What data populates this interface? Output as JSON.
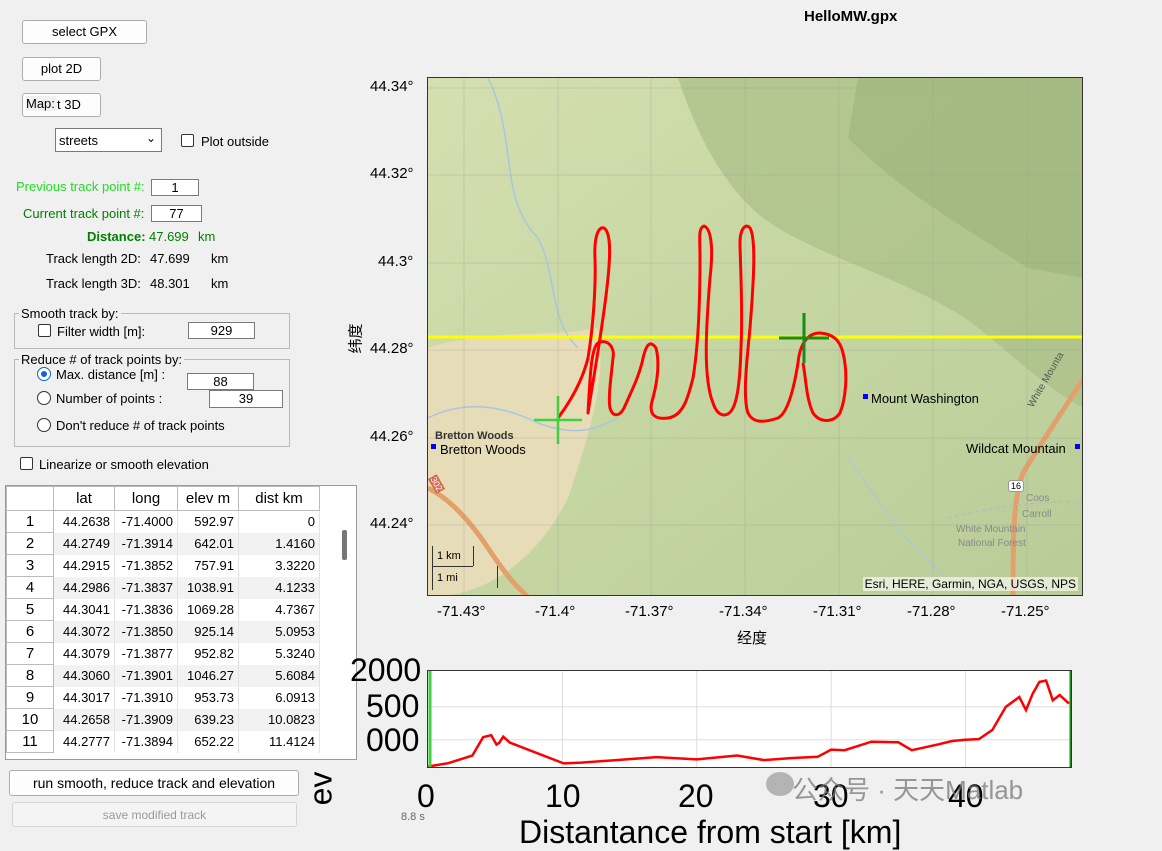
{
  "title": "HelloMW.gpx",
  "buttons": {
    "select_gpx": "select GPX",
    "plot_2d": "plot 2D",
    "plot_3d": "t 3D",
    "map_label": "Map:",
    "run": "run smooth, reduce track and elevation",
    "save": "save modified track"
  },
  "map_style": {
    "selected": "streets"
  },
  "plot_outside": {
    "label": "Plot outside",
    "checked": false
  },
  "track": {
    "prev_label": "Previous track point #:",
    "prev_value": "1",
    "cur_label": "Current track point #:",
    "cur_value": "77",
    "distance_label": "Distance:",
    "distance_value": "47.699",
    "distance_unit": "km",
    "len2d_label": "Track length 2D:",
    "len2d_value": "47.699",
    "len2d_unit": "km",
    "len3d_label": "Track length 3D:",
    "len3d_value": "48.301",
    "len3d_unit": "km"
  },
  "smooth": {
    "title": "Smooth track by:",
    "filter_label": "Filter width [m]:",
    "filter_value": "929",
    "checked": false
  },
  "reduce": {
    "title": "Reduce # of track points by:",
    "max_dist_label": "Max. distance [m] :",
    "max_dist_value": "88",
    "num_points_label": "Number of points :",
    "num_points_value": "39",
    "dont_reduce_label": "Don't reduce # of track points",
    "selected": "max_distance"
  },
  "linearize": {
    "label": "Linearize or smooth elevation",
    "checked": false
  },
  "table": {
    "headers": [
      "lat",
      "long",
      "elev m",
      "dist km"
    ],
    "rows": [
      [
        "1",
        "44.2638",
        "-71.4000",
        "592.97",
        "0"
      ],
      [
        "2",
        "44.2749",
        "-71.3914",
        "642.01",
        "1.4160"
      ],
      [
        "3",
        "44.2915",
        "-71.3852",
        "757.91",
        "3.3220"
      ],
      [
        "4",
        "44.2986",
        "-71.3837",
        "1038.91",
        "4.1233"
      ],
      [
        "5",
        "44.3041",
        "-71.3836",
        "1069.28",
        "4.7367"
      ],
      [
        "6",
        "44.3072",
        "-71.3850",
        "925.14",
        "5.0953"
      ],
      [
        "7",
        "44.3079",
        "-71.3877",
        "952.82",
        "5.3240"
      ],
      [
        "8",
        "44.3060",
        "-71.3901",
        "1046.27",
        "5.6084"
      ],
      [
        "9",
        "44.3017",
        "-71.3910",
        "953.73",
        "6.0913"
      ],
      [
        "10",
        "44.2658",
        "-71.3909",
        "639.23",
        "10.0823"
      ],
      [
        "11",
        "44.2777",
        "-71.3894",
        "652.22",
        "11.4124"
      ]
    ]
  },
  "map": {
    "y_ticks": [
      "44.34°",
      "44.32°",
      "44.3°",
      "44.28°",
      "44.26°",
      "44.24°"
    ],
    "x_ticks": [
      "-71.43°",
      "-71.4°",
      "-71.37°",
      "-71.34°",
      "-71.31°",
      "-71.28°",
      "-71.25°"
    ],
    "ylabel": "纬度",
    "xlabel": "经度",
    "places": [
      "Bretton Woods",
      "Bretton Woods",
      "Mount Washington",
      "Wildcat Mountain",
      "Coos",
      "Carroll",
      "White Mountain",
      "National Forest",
      "White Mounta",
      "16",
      "302"
    ],
    "scale_km": "1 km",
    "scale_mi": "1 mi",
    "attribution": "Esri, HERE, Garmin, NGA, USGS, NPS"
  },
  "elevation_chart": {
    "y_ticks": [
      "2000",
      "500",
      "000"
    ],
    "x_ticks": [
      "0",
      "10",
      "20",
      "30",
      "40"
    ],
    "xlabel": "Distantance from start [km]",
    "ylabel": "ev",
    "time_text": "8.8 s"
  },
  "watermark": "公众号 · 天天Matlab",
  "colors": {
    "track": "#ff0000",
    "start": "#3fd13f",
    "current": "#1a8a1a",
    "yellow": "#ffff00",
    "prev_label": "#00c800",
    "cur_label": "#008000"
  },
  "chart_data": {
    "type": "line",
    "x": [
      0,
      1.5,
      3.3,
      4.1,
      4.7,
      5.1,
      5.3,
      5.6,
      6.1,
      10.1,
      11.4,
      14,
      17,
      20,
      23,
      25,
      27,
      29,
      30,
      31,
      33,
      35,
      36,
      38,
      39,
      40,
      41,
      42,
      43,
      44,
      44.5,
      45,
      45.5,
      46,
      46.5,
      47,
      47.7
    ],
    "y": [
      593,
      642,
      758,
      1039,
      1069,
      925,
      953,
      1046,
      954,
      639,
      652,
      690,
      735,
      700,
      760,
      690,
      720,
      740,
      850,
      840,
      970,
      960,
      840,
      930,
      980,
      1000,
      1010,
      1150,
      1500,
      1650,
      1450,
      1700,
      1880,
      1900,
      1600,
      1680,
      1550
    ],
    "xlim": [
      0,
      48
    ],
    "ylim": [
      600,
      2000
    ],
    "xlabel": "Distantance from start [km]"
  }
}
